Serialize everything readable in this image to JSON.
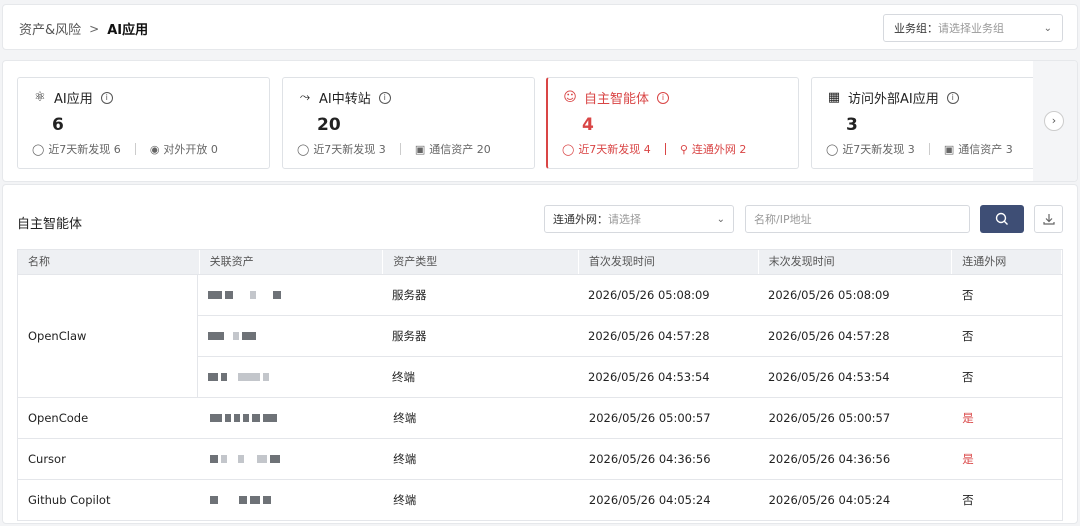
{
  "breadcrumb": {
    "parent": "资产&风险",
    "separator": ">",
    "current": "AI应用"
  },
  "business_group": {
    "label": "业务组：",
    "placeholder": "请选择业务组"
  },
  "cards": [
    {
      "title": "AI应用",
      "icon": "ai-app-icon",
      "count": "6",
      "stats": [
        {
          "icon": "bulb-icon",
          "text": "近7天新发现 6"
        },
        {
          "icon": "globe-icon",
          "text": "对外开放 0"
        }
      ]
    },
    {
      "title": "AI中转站",
      "icon": "relay-icon",
      "count": "20",
      "stats": [
        {
          "icon": "bulb-icon",
          "text": "近7天新发现 3"
        },
        {
          "icon": "asset-icon",
          "text": "通信资产 20"
        }
      ]
    },
    {
      "title": "自主智能体",
      "icon": "agent-icon",
      "count": "4",
      "stats": [
        {
          "icon": "bulb-icon",
          "text": "近7天新发现 4"
        },
        {
          "icon": "network-icon",
          "text": "连通外网 2"
        }
      ]
    },
    {
      "title": "访问外部AI应用",
      "icon": "apps-icon",
      "count": "3",
      "stats": [
        {
          "icon": "bulb-icon",
          "text": "近7天新发现 3"
        },
        {
          "icon": "asset-icon",
          "text": "通信资产 3"
        }
      ]
    }
  ],
  "main": {
    "title": "自主智能体",
    "filter": {
      "label": "连通外网：",
      "placeholder": "请选择"
    },
    "search": {
      "placeholder": "名称/IP地址"
    }
  },
  "table": {
    "columns": [
      "名称",
      "关联资产",
      "资产类型",
      "首次发现时间",
      "末次发现时间",
      "连通外网"
    ],
    "groups": [
      {
        "name": "OpenClaw",
        "rows": [
          {
            "type": "服务器",
            "first": "2026/05/26 05:08:09",
            "last": "2026/05/26 05:08:09",
            "external": "否"
          },
          {
            "type": "服务器",
            "first": "2026/05/26 04:57:28",
            "last": "2026/05/26 04:57:28",
            "external": "否"
          },
          {
            "type": "终端",
            "first": "2026/05/26 04:53:54",
            "last": "2026/05/26 04:53:54",
            "external": "否"
          }
        ]
      },
      {
        "name": "OpenCode",
        "rows": [
          {
            "type": "终端",
            "first": "2026/05/26 05:00:57",
            "last": "2026/05/26 05:00:57",
            "external": "是"
          }
        ]
      },
      {
        "name": "Cursor",
        "rows": [
          {
            "type": "终端",
            "first": "2026/05/26 04:36:56",
            "last": "2026/05/26 04:36:56",
            "external": "是"
          }
        ]
      },
      {
        "name": "Github Copilot",
        "rows": [
          {
            "type": "终端",
            "first": "2026/05/26 04:05:24",
            "last": "2026/05/26 04:05:24",
            "external": "否"
          }
        ]
      }
    ]
  },
  "colors": {
    "accent_red": "#d94545",
    "button_navy": "#3e4e75"
  }
}
